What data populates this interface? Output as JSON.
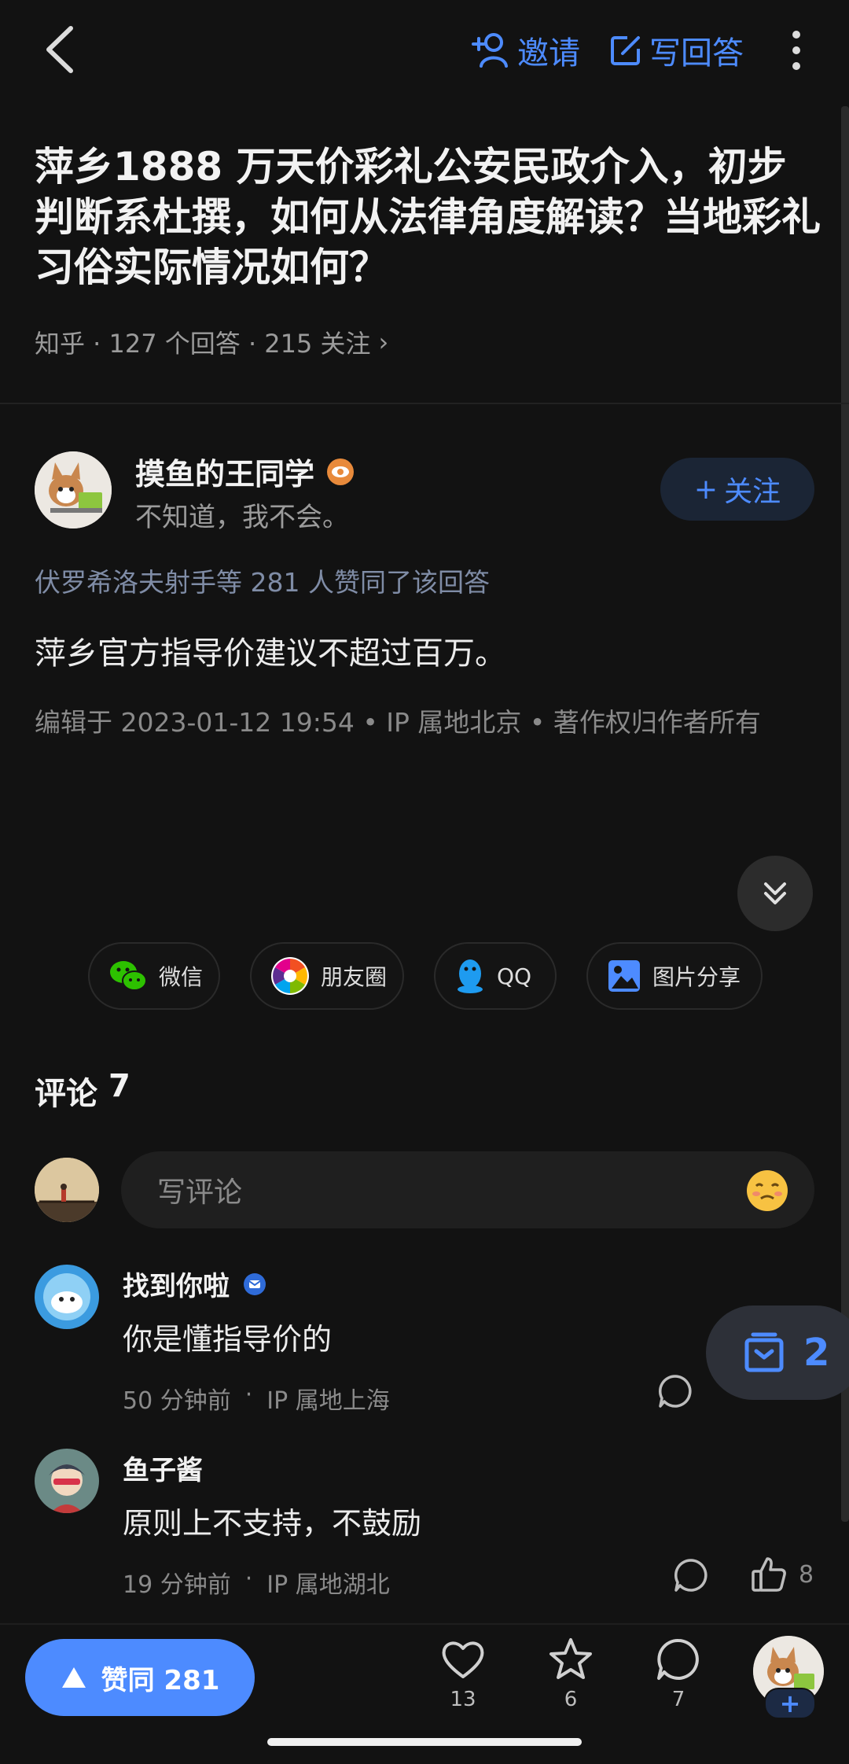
{
  "topbar": {
    "invite_label": "邀请",
    "write_label": "写回答"
  },
  "question": {
    "title": "萍乡1888 万天价彩礼公安民政介入，初步判断系杜撰，如何从法律角度解读？当地彩礼习俗实际情况如何？",
    "meta": "知乎 · 127 个回答 · 215 关注",
    "meta_arrow": "›"
  },
  "author": {
    "name": "摸鱼的王同学",
    "bio": "不知道，我不会。",
    "follow_label": "关注",
    "follow_plus": "+"
  },
  "answer": {
    "likers": "伏罗希洛夫射手等 281 人赞同了该回答",
    "text": "萍乡官方指导价建议不超过百万。",
    "edit_meta": "编辑于 2023-01-12 19:54 • IP 属地北京 • 著作权归作者所有"
  },
  "share": {
    "wechat": "微信",
    "moments": "朋友圈",
    "qq": "QQ",
    "image": "图片分享"
  },
  "comments": {
    "title": "评论",
    "count": "7",
    "input_placeholder": "写评论",
    "items": [
      {
        "name": "找到你啦",
        "text": "你是懂指导价的",
        "time": "50 分钟前",
        "ip": "IP 属地上海"
      },
      {
        "name": "鱼子酱",
        "text": "原则上不支持，不鼓励",
        "time": "19 分钟前",
        "ip": "IP 属地湖北",
        "likes": "8"
      }
    ]
  },
  "float_fav": {
    "count": "2"
  },
  "bottom": {
    "agree_label": "赞同 281",
    "like_count": "13",
    "star_count": "6",
    "comment_count": "7",
    "plus": "+"
  },
  "colors": {
    "accent": "#4d8bff",
    "background": "#121212",
    "text": "#ededed"
  },
  "icons": [
    "back-icon",
    "add-user-icon",
    "edit-icon",
    "more-icon",
    "chevron-down-double-icon",
    "wechat-icon",
    "moments-icon",
    "qq-icon",
    "image-icon",
    "emoji-icon",
    "verified-icon",
    "reply-icon",
    "like-icon",
    "collect-icon",
    "heart-icon",
    "star-icon",
    "comment-icon",
    "triangle-up-icon"
  ]
}
